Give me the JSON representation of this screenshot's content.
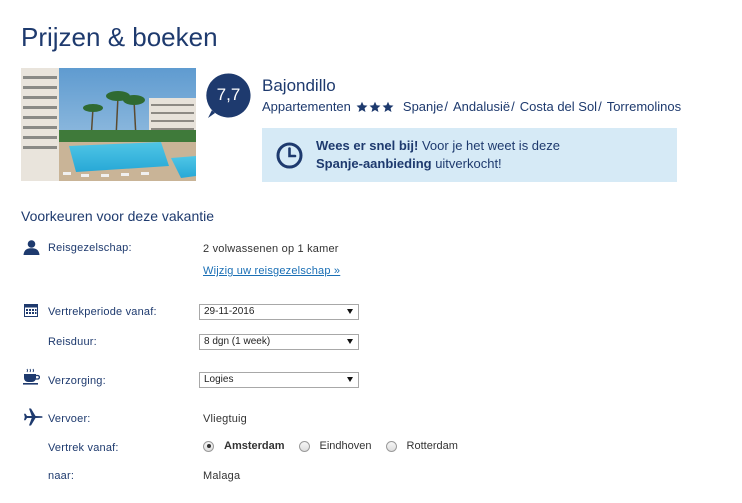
{
  "page": {
    "title": "Prijzen & boeken"
  },
  "hotel": {
    "rating": "7,7",
    "name": "Bajondillo",
    "type": "Appartementen",
    "stars": 3,
    "location": [
      "Spanje",
      "Andalusië",
      "Costa del Sol",
      "Torremolinos"
    ]
  },
  "alert": {
    "bold1": "Wees er snel bij!",
    "text1": " Voor je het weet is deze ",
    "bold2": "Spanje-aanbieding",
    "text2": " uitverkocht!"
  },
  "preferences": {
    "title": "Voorkeuren voor deze vakantie",
    "travel_party": {
      "label": "Reisgezelschap:",
      "value": "2 volwassenen op 1 kamer",
      "change_link": "Wijzig uw reisgezelschap »"
    },
    "departure_period": {
      "label": "Vertrekperiode vanaf:",
      "selected": "29-11-2016"
    },
    "duration": {
      "label": "Reisduur:",
      "selected": "8 dgn (1 week)"
    },
    "board": {
      "label": "Verzorging:",
      "selected": "Logies"
    },
    "transport": {
      "label": "Vervoer:",
      "value": "Vliegtuig"
    },
    "departure_from": {
      "label": "Vertrek vanaf:",
      "options": [
        "Amsterdam",
        "Eindhoven",
        "Rotterdam"
      ],
      "selected": "Amsterdam"
    },
    "destination": {
      "label": "naar:",
      "value": "Malaga"
    }
  },
  "colors": {
    "brand": "#1e3a6e",
    "link": "#1a6fb5",
    "alert_bg": "#d6eaf6"
  }
}
